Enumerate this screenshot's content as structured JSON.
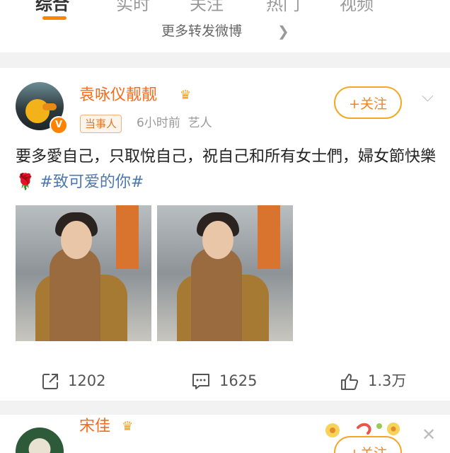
{
  "tabs": [
    {
      "label": "综合",
      "active": true
    },
    {
      "label": "实时",
      "active": false
    },
    {
      "label": "关注",
      "active": false
    },
    {
      "label": "热门",
      "active": false
    },
    {
      "label": "视频",
      "active": false
    }
  ],
  "more_forwards": "更多转发微博",
  "post": {
    "username": "袁咏仪靓靓",
    "badge": "当事人",
    "time": "6小时前",
    "source": "艺人",
    "follow_label": "关注",
    "text_part1": "要多愛自己，只取悅自己，祝自己和所有女士們，婦女節快樂",
    "emoji": "🌹",
    "topic": "#致可爱的你#",
    "photos": 2,
    "reposts": "1202",
    "comments": "1625",
    "likes": "1.3万"
  },
  "post2": {
    "username": "宋佳",
    "follow_label": "关注"
  },
  "colors": {
    "accent": "#ff8200",
    "username": "#f86b1d",
    "topic": "#4b78b0"
  }
}
